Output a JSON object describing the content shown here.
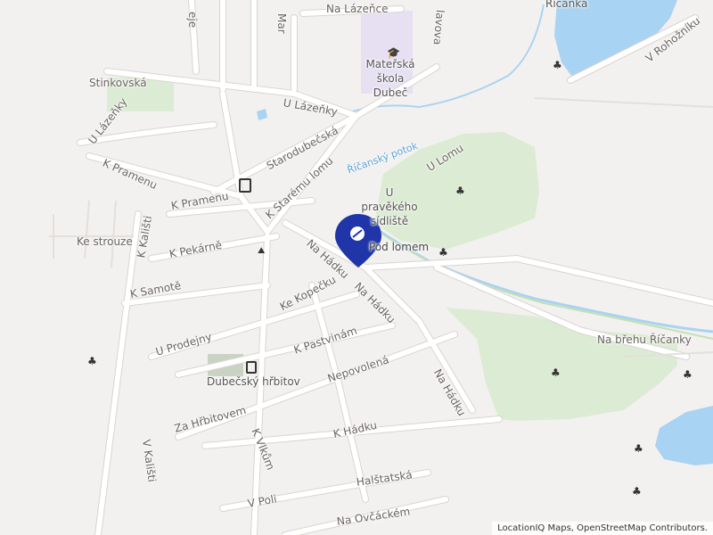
{
  "map": {
    "colors": {
      "land": "#f3f1ef",
      "forest": "#dcebd3",
      "water": "#a9d3f2",
      "road": "#ffffff",
      "road_casing": "#d9d4d0",
      "marker": "#1f35a8",
      "school": "#e7e0f2"
    },
    "marker_label": "Pod lomem",
    "attribution": "LocationIQ Maps, OpenStreetMap Contributors.",
    "streets": {
      "na_lazence": "Na Lázeňce",
      "mar": "Mar",
      "eje": "eje",
      "lavova": "lavova",
      "stinkovska": "Stinkovská",
      "u_lazenky_1": "U Lázeňky",
      "u_lazenky_2": "U Lázeňky",
      "starodubecska": "Starodubečská",
      "k_pramenu_1": "K Pramenu",
      "k_pramenu_2": "K Pramenu",
      "k_staremu_lomu": "K Starému lomu",
      "u_lomu": "U Lomu",
      "ke_strouze": "Ke strouze",
      "k_kalisti_1": "K Kališti",
      "k_kalisti_2": "V Kališti",
      "k_pekarne": "K Pekárně",
      "na_hadku_1": "Na Hádku",
      "na_hadku_2": "Na Hádku",
      "na_hadku_3": "Na Hádku",
      "k_samote": "K Samotě",
      "ke_kopecku": "Ke Kopečku",
      "u_prodejny": "U Prodejny",
      "k_pastvinam": "K Pastvinám",
      "nepovolena": "Nepovolená",
      "za_hrbitovem": "Za Hřbitovem",
      "k_vlkum": "K Vlkům",
      "k_hadku": "K Hádku",
      "halstatska": "Halštatská",
      "v_poli": "V Poli",
      "na_ovcackem": "Na Ovčáckém",
      "v_rohozniku": "V Rohožníku",
      "na_brehu_ricanky": "Na břehu Říčanky"
    },
    "pois": {
      "school": "Mateřská škola Dubeč",
      "settlement": "U pravěkého sídliště",
      "cemetery": "Dubečský hřbitov",
      "ricanka": "Říčanka"
    },
    "water": {
      "stream": "Říčanský potok"
    },
    "icons": [
      "school-icon",
      "bus-stop-icon",
      "tree-icon",
      "marker-pin-icon",
      "cave-icon"
    ]
  }
}
